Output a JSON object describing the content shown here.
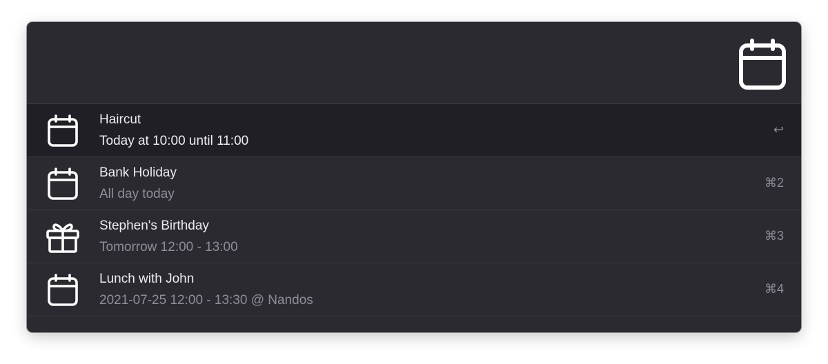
{
  "header": {
    "icon": "calendar-icon"
  },
  "results": [
    {
      "icon": "calendar-icon",
      "title": "Haircut",
      "subtitle": "Today at 10:00 until 11:00",
      "shortcut": "↩",
      "selected": true
    },
    {
      "icon": "calendar-icon",
      "title": "Bank Holiday",
      "subtitle": "All day today",
      "shortcut": "⌘2",
      "selected": false
    },
    {
      "icon": "gift-icon",
      "title": "Stephen's Birthday",
      "subtitle": "Tomorrow 12:00 - 13:00",
      "shortcut": "⌘3",
      "selected": false
    },
    {
      "icon": "calendar-icon",
      "title": "Lunch with John",
      "subtitle": "2021-07-25 12:00 - 13:30 @ Nandos",
      "shortcut": "⌘4",
      "selected": false
    }
  ],
  "colors": {
    "background": "#2b2a31",
    "selected_row": "#201f25",
    "primary_text": "#ececf0",
    "secondary_text": "#8e8d99"
  }
}
